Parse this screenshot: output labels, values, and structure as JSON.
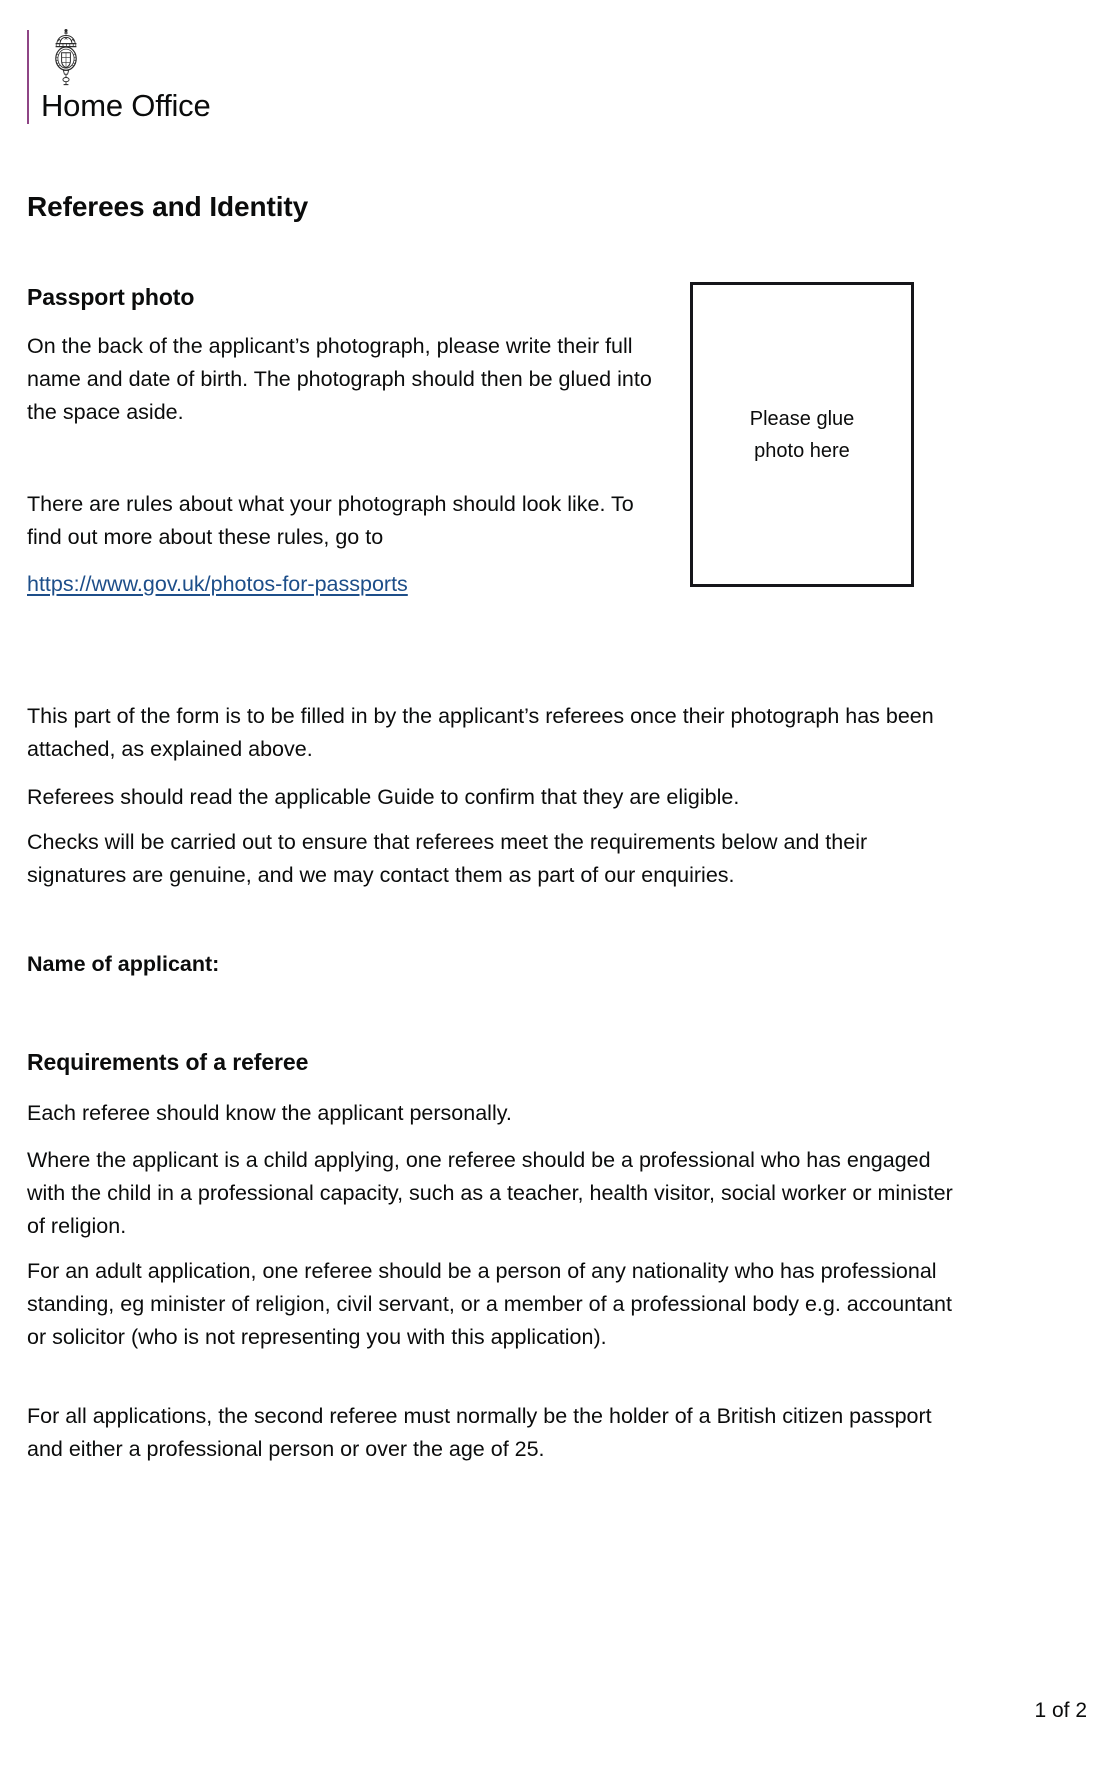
{
  "masthead": {
    "wordmark": "Home Office",
    "crest_icon": "royal-crest-icon",
    "rule_color": "#8e4585"
  },
  "document": {
    "title": "Referees and Identity"
  },
  "passport_photo": {
    "heading": "Passport photo",
    "paragraph_1": "On the back of the applicant’s photograph, please write their full name and date of birth. The photograph should then be glued into the space aside.",
    "paragraph_2": "There are rules about what your photograph should look like. To find out more about these rules, go to",
    "link_text": "https://www.gov.uk/photos-for-passports",
    "link_color": "#1d4e89",
    "photo_box_label_line_1": "Please glue",
    "photo_box_label_line_2": "photo here"
  },
  "intro": {
    "paragraph_1": "This part of the form is to be filled in by the applicant’s referees once their photograph has been attached, as explained above.",
    "paragraph_2": "Referees should read the applicable Guide to confirm that they are eligible.",
    "paragraph_3": "Checks will be carried out to ensure that referees meet the requirements below and their signatures are genuine, and we may contact them as part of our enquiries.",
    "applicant_name_label": "Name of applicant:"
  },
  "requirements": {
    "heading": "Requirements of a referee",
    "paragraph_1": "Each referee should know the applicant personally.",
    "paragraph_2": "Where the applicant is a child applying, one referee should be a professional who has engaged with the child in a professional capacity, such as a teacher, health visitor, social worker or minister of religion.",
    "paragraph_3": "For an adult application, one referee should be a person of any nationality who has professional standing, eg minister of religion, civil servant, or a member of a professional body e.g. accountant or solicitor (who is not representing you with this application).",
    "paragraph_4": "For all applications, the second referee must normally be the holder of a British citizen passport and either a professional person or over the age of 25."
  },
  "footer": {
    "page_indicator": "1 of 2"
  }
}
